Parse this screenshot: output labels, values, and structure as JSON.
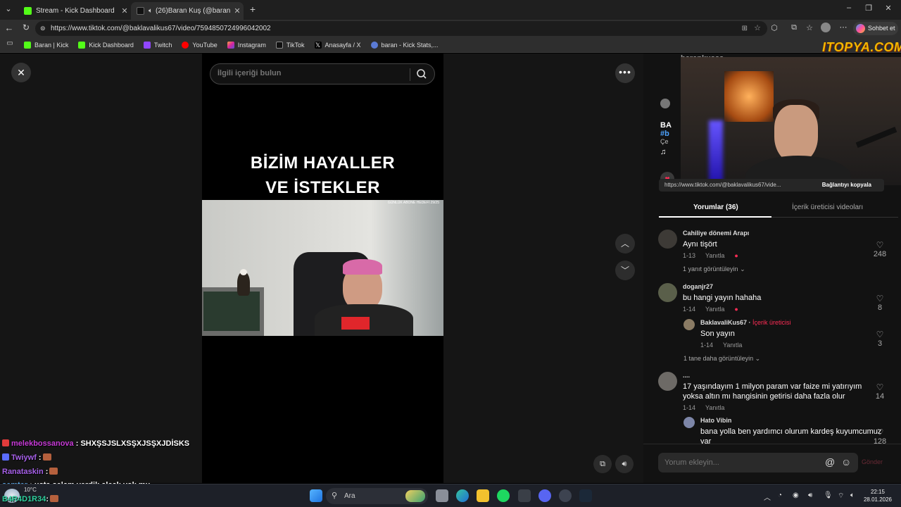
{
  "browser": {
    "tabs": [
      {
        "title": "Stream - Kick Dashboard"
      },
      {
        "title": "(26)Baran Kuş (@barankusss)"
      }
    ],
    "url": "https://www.tiktok.com/@baklavalikus67/video/7594850724996042002",
    "bookmarks": [
      "Baran | Kick",
      "Kick Dashboard",
      "Twitch",
      "YouTube",
      "Instagram",
      "TikTok",
      "Anasayfa / X",
      "baran - Kick Stats,..."
    ],
    "copilot_label": "Sohbet et"
  },
  "video": {
    "search_placeholder": "İlgili içeriği bulun",
    "title_line1": "BİZİM HAYALLER",
    "title_line2": "VE İSTEKLER",
    "hud_text": "GÜNLÜK ABONE HEDEFİ  29/25"
  },
  "panel": {
    "cam_name": "barankusss",
    "partial_lines": [
      "BA",
      "#b",
      "Çe",
      "♫"
    ],
    "link_text": "https://www.tiktok.com/@baklavalikus67/vide...",
    "copy_link": "Bağlantıyı kopyala",
    "tab_comments": "Yorumlar (36)",
    "tab_creator": "İçerik üreticisi videoları",
    "comments": [
      {
        "user": "Cahiliye dönemi Arapı",
        "text": "Aynı tişört",
        "date": "1-13",
        "reply": "Yanıtla",
        "likes": "248",
        "more": "1 yanıt görüntüleyin"
      },
      {
        "user": "doganjr27",
        "text": "bu hangi yayın hahaha",
        "date": "1-14",
        "reply": "Yanıtla",
        "likes": "8"
      },
      {
        "user": "BaklavaliKus67",
        "badge": "İçerik üreticisi",
        "text": "Son yayın",
        "date": "1-14",
        "reply": "Yanıtla",
        "likes": "3",
        "more": "1 tane daha görüntüleyin"
      },
      {
        "user": "....",
        "text": "17 yaşındayım 1 milyon param var faize mi yatırıyım yoksa altın mı hangisinin getirisi daha fazla olur",
        "date": "1-14",
        "reply": "Yanıtla",
        "likes": "14"
      },
      {
        "user": "Hato Vibin",
        "text": "bana yolla ben yardımcı olurum kardeş kuyumcumuz var",
        "likes": "128"
      }
    ],
    "comment_placeholder": "Yorum ekleyin...",
    "send": "Gönder"
  },
  "watermark": "ITOPYA.COM",
  "chat": [
    {
      "user": "melekbossanova",
      "msg": ": SHXŞSJSLXSŞXJSŞXJDİSKS",
      "color": "#c63ad6"
    },
    {
      "user": "Twiywf",
      "msg": ":",
      "color": "#a660e8"
    },
    {
      "user": "Ranataskin",
      "msg": ":",
      "color": "#a660e8"
    },
    {
      "user": "semter",
      "msg": ": usta selam verdik alcak yok mu",
      "color": "#5aa7e6"
    },
    {
      "user": "B4R4D1R34",
      "msg": ":",
      "color": "#2fd3a0"
    }
  ],
  "taskbar": {
    "search": "Ara",
    "weather": "10°C",
    "time": "22:15",
    "date": "28.01.2026"
  }
}
